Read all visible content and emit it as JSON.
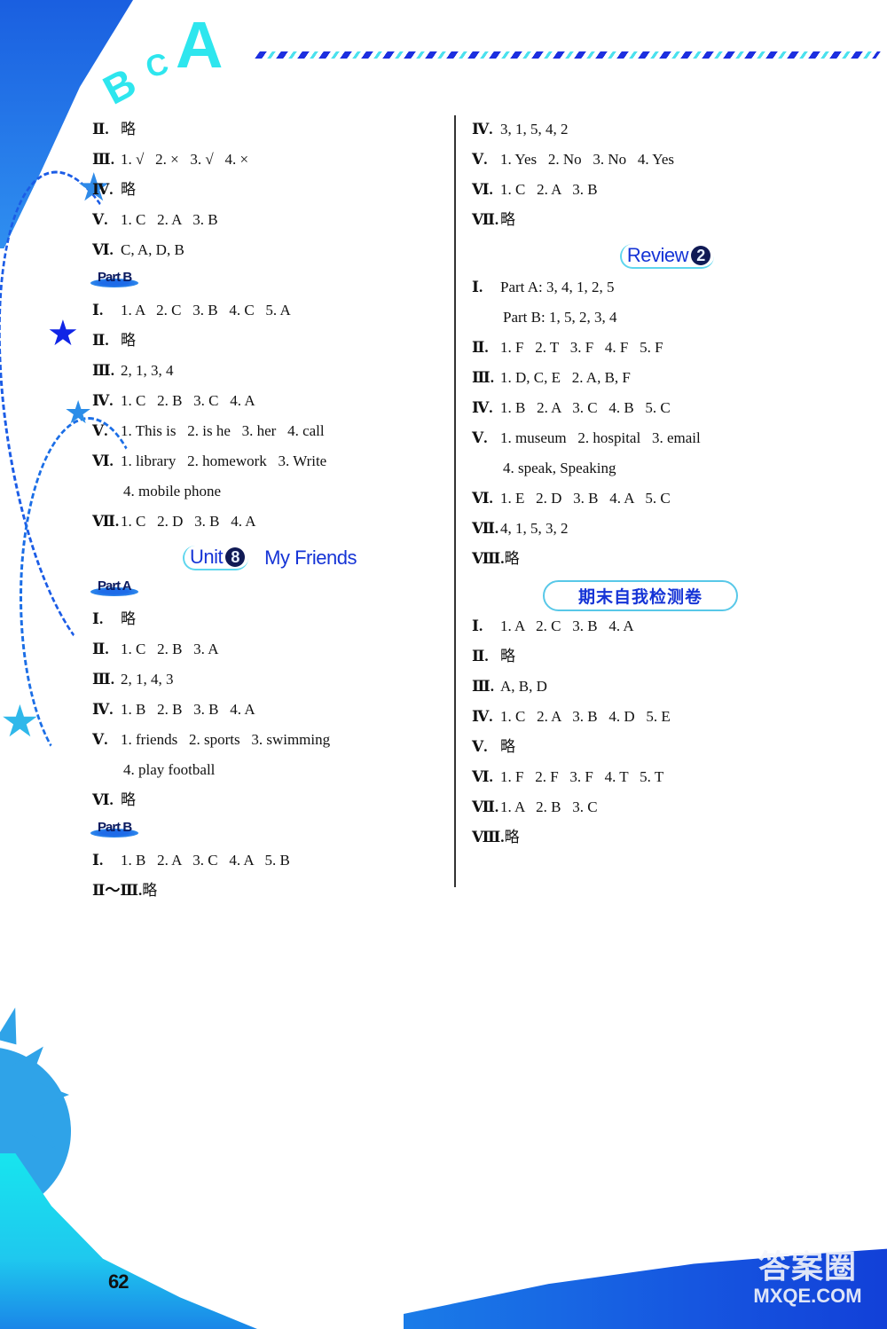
{
  "decoration": {
    "letters": [
      "B",
      "C",
      "A"
    ],
    "star_icon": "★"
  },
  "page": {
    "number": "62",
    "watermark_line1": "答案圈",
    "watermark_line2": "MXQE.COM"
  },
  "left_column": {
    "top_lines": [
      {
        "num": "Ⅱ.",
        "text": "略"
      },
      {
        "num": "Ⅲ.",
        "text": "1. √   2. ×   3. √   4. ×"
      },
      {
        "num": "Ⅳ.",
        "text": "略"
      },
      {
        "num": "Ⅴ.",
        "text": "1. C   2. A   3. B"
      },
      {
        "num": "Ⅵ.",
        "text": "C, A, D, B"
      }
    ],
    "part_b_1": {
      "label": "Part B",
      "lines": [
        {
          "num": "Ⅰ.",
          "text": "1. A   2. C   3. B   4. C   5. A"
        },
        {
          "num": "Ⅱ.",
          "text": "略"
        },
        {
          "num": "Ⅲ.",
          "text": "2, 1, 3, 4"
        },
        {
          "num": "Ⅳ.",
          "text": "1. C   2. B   3. C   4. A"
        },
        {
          "num": "Ⅴ.",
          "text": "1. This is   2. is he   3. her   4. call"
        },
        {
          "num": "Ⅵ.",
          "text": "1. library   2. homework   3. Write"
        },
        {
          "num": "",
          "text": "4. mobile phone"
        },
        {
          "num": "Ⅶ.",
          "text": "1. C   2. D   3. B   4. A"
        }
      ]
    },
    "unit_heading": {
      "unit_label": "Unit",
      "unit_number": "8",
      "title": "My Friends"
    },
    "part_a": {
      "label": "Part A",
      "lines": [
        {
          "num": "Ⅰ.",
          "text": "略"
        },
        {
          "num": "Ⅱ.",
          "text": "1. C   2. B   3. A"
        },
        {
          "num": "Ⅲ.",
          "text": "2, 1, 4, 3"
        },
        {
          "num": "Ⅳ.",
          "text": "1. B   2. B   3. B   4. A"
        },
        {
          "num": "Ⅴ.",
          "text": "1. friends   2. sports   3. swimming"
        },
        {
          "num": "",
          "text": "4. play football"
        },
        {
          "num": "Ⅵ.",
          "text": "略"
        }
      ]
    },
    "part_b_2": {
      "label": "Part B",
      "lines": [
        {
          "num": "Ⅰ.",
          "text": "1. B   2. A   3. C   4. A   5. B"
        },
        {
          "num": "Ⅱ～Ⅲ.",
          "text": "略"
        }
      ]
    }
  },
  "right_column": {
    "top_lines": [
      {
        "num": "Ⅳ.",
        "text": "3, 1, 5, 4, 2"
      },
      {
        "num": "Ⅴ.",
        "text": "1. Yes   2. No   3. No   4. Yes"
      },
      {
        "num": "Ⅵ.",
        "text": "1. C   2. A   3. B"
      },
      {
        "num": "Ⅶ.",
        "text": "略"
      }
    ],
    "review_heading": {
      "label": "Review",
      "number": "2"
    },
    "review_lines": [
      {
        "num": "Ⅰ.",
        "text": "Part A: 3, 4, 1, 2, 5"
      },
      {
        "num": "",
        "text": "Part B: 1, 5, 2, 3, 4"
      },
      {
        "num": "Ⅱ.",
        "text": "1. F   2. T   3. F   4. F   5. F"
      },
      {
        "num": "Ⅲ.",
        "text": "1. D, C, E   2. A, B, F"
      },
      {
        "num": "Ⅳ.",
        "text": "1. B   2. A   3. C   4. B   5. C"
      },
      {
        "num": "Ⅴ.",
        "text": "1. museum   2. hospital   3. email"
      },
      {
        "num": "",
        "text": "4. speak, Speaking"
      },
      {
        "num": "Ⅵ.",
        "text": "1. E   2. D   3. B   4. A   5. C"
      },
      {
        "num": "Ⅶ.",
        "text": "4, 1, 5, 3, 2"
      },
      {
        "num": "Ⅷ.",
        "text": "略"
      }
    ],
    "exam_heading": "期末自我检测卷",
    "exam_lines": [
      {
        "num": "Ⅰ.",
        "text": "1. A   2. C   3. B   4. A"
      },
      {
        "num": "Ⅱ.",
        "text": "略"
      },
      {
        "num": "Ⅲ.",
        "text": "A, B, D"
      },
      {
        "num": "Ⅳ.",
        "text": "1. C   2. A   3. B   4. D   5. E"
      },
      {
        "num": "Ⅴ.",
        "text": "略"
      },
      {
        "num": "Ⅵ.",
        "text": "1. F   2. F   3. F   4. T   5. T"
      },
      {
        "num": "Ⅶ.",
        "text": "1. A   2. B   3. C"
      },
      {
        "num": "Ⅷ.",
        "text": "略"
      }
    ]
  }
}
